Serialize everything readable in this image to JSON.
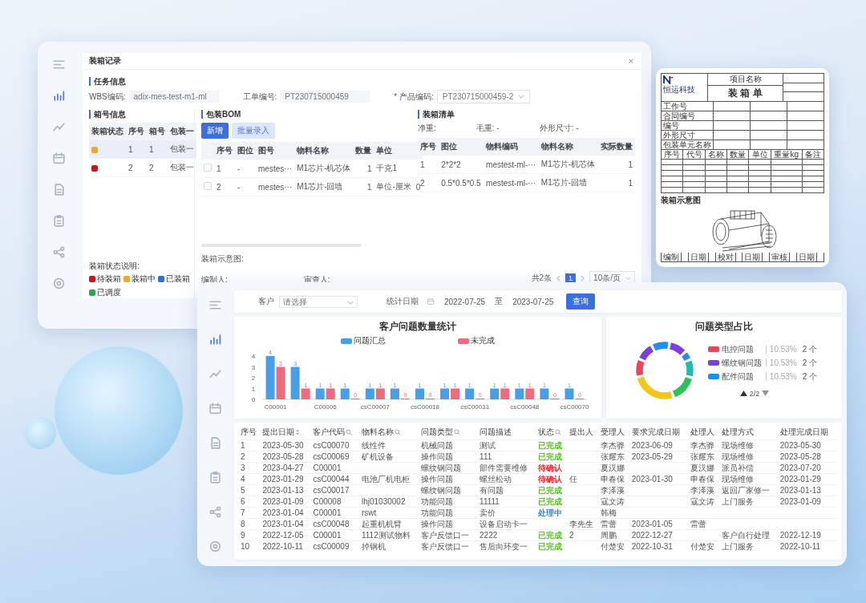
{
  "packing_window": {
    "sidebar": {
      "items": [
        {
          "selected": false
        },
        {
          "selected": true
        },
        {
          "selected": false
        },
        {
          "selected": false
        },
        {
          "selected": false
        },
        {
          "selected": false
        },
        {
          "selected": false
        },
        {
          "selected": false
        }
      ]
    },
    "title": "装箱记录",
    "close": "×",
    "task_info": {
      "heading": "任务信息",
      "fields": [
        {
          "label": "WBS编码:",
          "value": "adix-mes-test-m1-ml",
          "kind": "input"
        },
        {
          "label": "工单编号:",
          "value": "PT230715000459",
          "kind": "input"
        },
        {
          "label": "* 产品编码:",
          "value": "PT230715000459-2",
          "kind": "select"
        }
      ]
    },
    "box_info": {
      "heading": "箱号信息",
      "columns": [
        "装箱状态",
        "序号",
        "箱号",
        "包装一"
      ],
      "rows": [
        {
          "color": "#f5a623",
          "cells": [
            "",
            "1",
            "1",
            "包装一"
          ],
          "selected": true
        },
        {
          "color": "#c8161d",
          "cells": [
            "",
            "2",
            "2",
            "包装一"
          ],
          "selected": false
        }
      ],
      "legend_label": "装箱状态说明:",
      "legend": [
        {
          "text": "待装箱",
          "color": "#c8161d"
        },
        {
          "text": "装箱中",
          "color": "#f5a623"
        },
        {
          "text": "已装箱",
          "color": "#2f6fdc"
        },
        {
          "text": "已调度",
          "color": "#2ea44f"
        }
      ]
    },
    "bom": {
      "heading": "包装BOM",
      "buttons": [
        {
          "label": "新增",
          "disabled": false
        },
        {
          "label": "批量录入",
          "disabled": true
        }
      ],
      "columns": [
        "序号",
        "图位",
        "图号",
        "物料名称",
        "数量",
        "单位"
      ],
      "rows": [
        {
          "checked": false,
          "cells": [
            "1",
            "-",
            "mestes···",
            "M1芯片-机芯体",
            "1",
            "千克1"
          ]
        },
        {
          "checked": false,
          "cells": [
            "2",
            "-",
            "mestes···",
            "M1芯片-回墙",
            "1",
            "单位-厘米",
            "0"
          ]
        }
      ],
      "diagram_label": "装箱示意图:",
      "signers": [
        "编制人:",
        "审查人:"
      ]
    },
    "packing_list": {
      "heading": "装箱清单",
      "summary": [
        "净重:",
        "毛重: -",
        "外形尺寸: -"
      ],
      "columns": [
        "序号",
        "图位",
        "物料编码",
        "物料名称",
        "实际数量"
      ],
      "rows": [
        {
          "cells": [
            "1",
            "2*2*2",
            "mestest-ml-···",
            "M1芯片-机芯体",
            "1"
          ]
        },
        {
          "cells": [
            "2",
            "0.5*0.5*0.5",
            "mestest-ml-···",
            "M1芯片-回墙",
            "1"
          ]
        }
      ],
      "pager": {
        "total": "共2条",
        "pages": [
          {
            "label": "1",
            "selected": true
          }
        ],
        "page_size": "10条/页"
      }
    }
  },
  "packing_slip": {
    "logo": "恒运科技",
    "project_label": "项目名称",
    "title": "装 箱 单",
    "info_labels": [
      "工作号",
      "合同编号",
      "编号",
      "外形尺寸",
      "包装单元名称"
    ],
    "columns": [
      "序号",
      "代号",
      "名称",
      "数量",
      "单位",
      "重量kg",
      "备注"
    ],
    "diagram_title": "装箱示意图",
    "footer": [
      "编制",
      "日期",
      "校对",
      "日期",
      "审核",
      "日期"
    ]
  },
  "issue_window": {
    "sidebar": {
      "items": [
        {
          "selected": false
        },
        {
          "selected": true
        },
        {
          "selected": false
        },
        {
          "selected": false
        },
        {
          "selected": false
        },
        {
          "selected": false
        },
        {
          "selected": false
        },
        {
          "selected": false
        }
      ]
    },
    "filter": {
      "customer_label": "客户",
      "customer_placeholder": "请选择",
      "date_label": "统计日期",
      "start": "2022-07-25",
      "separator": "至",
      "end": "2023-07-25",
      "query_button": "查询"
    },
    "bar_chart": {
      "chart_data": {
        "type": "bar",
        "title": "客户问题数量统计",
        "categories": [
          "C00001",
          null,
          "C00006",
          null,
          "csC00007",
          null,
          "csC00018",
          null,
          "csC00031",
          null,
          "csC00048",
          null,
          "csC00070"
        ],
        "series": [
          {
            "name": "问题汇总",
            "color": "#4a9ee8",
            "values": [
              4,
              3,
              1,
              1,
              1,
              1,
              1,
              1,
              1,
              1,
              1,
              1,
              1
            ]
          },
          {
            "name": "未完成",
            "color": "#ee6b7e",
            "values": [
              3,
              1,
              1,
              0,
              1,
              0,
              0,
              1,
              0,
              1,
              1,
              0,
              0
            ]
          }
        ],
        "ylim": [
          0,
          4
        ],
        "yticks": [
          0,
          1,
          2,
          3,
          4
        ],
        "data_labels": true
      }
    },
    "donut": {
      "title": "问题类型占比",
      "legend": [
        {
          "name": "电控问题",
          "percent": "10.53%",
          "count": "2 个",
          "color": "#e8455a"
        },
        {
          "name": "螺纹钢问题",
          "percent": "10.53%",
          "count": "2 个",
          "color": "#7b3fe0"
        },
        {
          "name": "配件问题",
          "percent": "10.53%",
          "count": "2 个",
          "color": "#1f8ef1"
        }
      ],
      "page": "2/2"
    },
    "table": {
      "columns": [
        {
          "label": "序号"
        },
        {
          "label": "提出日期",
          "sortable": true
        },
        {
          "label": "客户代码",
          "filterable": true
        },
        {
          "label": "物料名称",
          "filterable": true
        },
        {
          "label": "问题类型",
          "filterable": true
        },
        {
          "label": "问题描述"
        },
        {
          "label": "状态",
          "filterable": true
        },
        {
          "label": "提出人"
        },
        {
          "label": "受理人"
        },
        {
          "label": "要求完成日期"
        },
        {
          "label": "处理人"
        },
        {
          "label": "处理方式"
        },
        {
          "label": "处理完成日期"
        }
      ],
      "rows": [
        {
          "color": "#52c41a",
          "cells": [
            "1",
            "2023-05-30",
            "csC00070",
            "线性件",
            "机械问题",
            "测试",
            "已完成",
            null,
            "李杰骅",
            "2023-06-09",
            "李杰骅",
            "现场维修",
            "2023-05-30"
          ]
        },
        {
          "color": "#52c41a",
          "cells": [
            "2",
            "2023-05-28",
            "csC00069",
            "矿机设备",
            "操作问题",
            "111",
            "已完成",
            null,
            "张耀东",
            "2023-05-29",
            "张耀东",
            "现场维修",
            "2023-05-28"
          ]
        },
        {
          "color": "#f5222d",
          "cells": [
            "3",
            "2023-04-27",
            "C00001",
            null,
            "螺纹钢问题",
            "部件需要维修",
            "待确认",
            null,
            "夏汉娜",
            null,
            "夏汉娜",
            "派员补偿",
            "2023-07-20"
          ]
        },
        {
          "color": "#f5222d",
          "cells": [
            "4",
            "2023-01-29",
            "csC00044",
            "电池厂机电柜",
            "操作问题",
            "螺丝松动",
            "待确认",
            "任",
            "申春保",
            "2023-01-30",
            "申春保",
            "现场维修",
            "2023-01-29"
          ]
        },
        {
          "color": "#52c41a",
          "cells": [
            "5",
            "2023-01-13",
            "csC00017",
            null,
            "螺纹钢问题",
            "有问题",
            "已完成",
            null,
            "李泽溪",
            null,
            "李泽溪",
            "返回厂家修一",
            "2023-01-13"
          ]
        },
        {
          "color": "#52c41a",
          "cells": [
            "6",
            "2023-01-09",
            "C00008",
            "lhj01030002",
            "功能问题",
            "11111",
            "已完成",
            null,
            "寇文涛",
            null,
            "寇文涛",
            "上门服务",
            "2023-01-09"
          ]
        },
        {
          "color": "#1890ff",
          "cells": [
            "7",
            "2023-01-04",
            "C00001",
            "rswt",
            "功能问题",
            "卖价",
            "处理中",
            null,
            "韩梅",
            null,
            null,
            null,
            null
          ]
        },
        {
          "cells": [
            "8",
            "2023-01-04",
            "csC00048",
            "起重机机臂",
            "操作问题",
            "设备启动卡一",
            null,
            "李先生",
            "雷蕾",
            "2023-01-05",
            "雷蕾",
            null,
            null
          ]
        },
        {
          "color": "#52c41a",
          "cells": [
            "9",
            "2022-12-05",
            "C00001",
            "1112测试物料",
            "客户反馈口一",
            "2222",
            "已完成",
            "2",
            "周鹏",
            "2022-12-27",
            null,
            "客户自行处理",
            "2022-12-19"
          ]
        },
        {
          "color": "#52c41a",
          "cells": [
            "10",
            "2022-10-11",
            "csC00009",
            "掉钢机",
            "客户反馈口一",
            "售后向环变一",
            "已完成",
            null,
            "付楚安",
            "2022-10-31",
            "付楚安",
            "上门服务",
            "2022-10-11"
          ]
        }
      ]
    }
  }
}
